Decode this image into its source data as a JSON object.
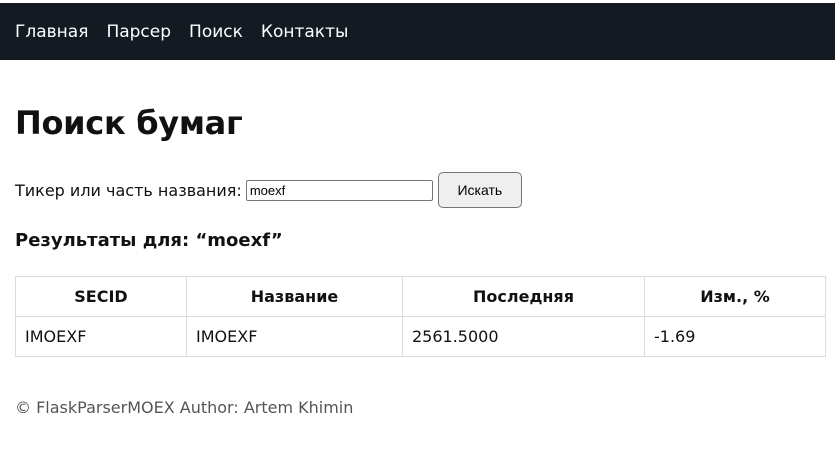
{
  "nav": {
    "items": [
      {
        "label": "Главная"
      },
      {
        "label": "Парсер"
      },
      {
        "label": "Поиск"
      },
      {
        "label": "Контакты"
      }
    ],
    "background": "#131a22"
  },
  "main": {
    "title": "Поиск бумаг",
    "search": {
      "label": "Тикер или часть названия:",
      "value": "moexf",
      "button_label": "Искать"
    },
    "results": {
      "heading": "Результаты для: “moexf”",
      "columns": [
        "SECID",
        "Название",
        "Последняя",
        "Изм., %"
      ],
      "rows": [
        [
          "IMOEXF",
          "IMOEXF",
          "2561.5000",
          "-1.69"
        ]
      ]
    }
  },
  "footer": {
    "text": "© FlaskParserMOEX Author: Artem Khimin"
  }
}
